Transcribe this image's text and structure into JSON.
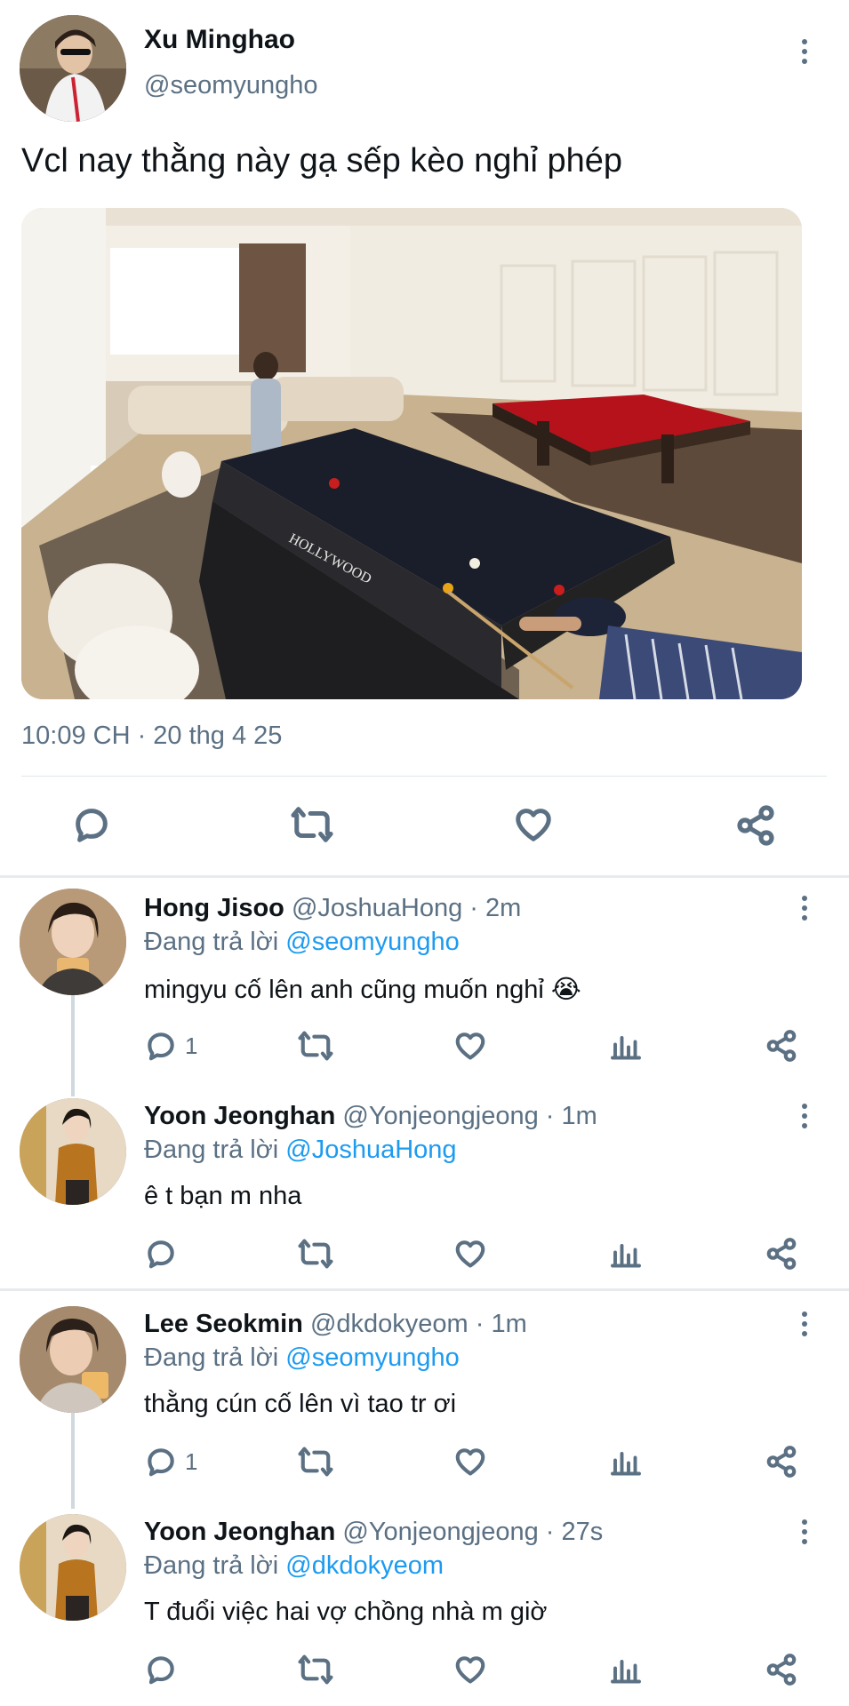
{
  "tweet": {
    "author": "Xu Minghao",
    "handle": "@seomyungho",
    "text": "Vcl nay thằng này gạ sếp kèo nghỉ phép",
    "timestamp": "10:09 CH · 20 thg 4 25",
    "photo_text": "HOLLYWOOD"
  },
  "replies": [
    {
      "name": "Hong Jisoo",
      "handle": "@JoshuaHong",
      "time": "· 2m",
      "replying_prefix": "Đang trả lời",
      "replying_to": "@seomyungho",
      "text": "mingyu cố lên anh cũng muốn nghỉ 😭",
      "reply_count": "1"
    },
    {
      "name": "Yoon Jeonghan",
      "handle": "@Yonjeongjeong",
      "time": "· 1m",
      "replying_prefix": "Đang trả lời",
      "replying_to": "@JoshuaHong",
      "text": "ê t bạn m nha",
      "reply_count": ""
    },
    {
      "name": "Lee Seokmin",
      "handle": "@dkdokyeom",
      "time": "· 1m",
      "replying_prefix": "Đang trả lời",
      "replying_to": "@seomyungho",
      "text": "thằng cún cố lên vì tao tr ơi",
      "reply_count": "1"
    },
    {
      "name": "Yoon Jeonghan",
      "handle": "@Yonjeongjeong",
      "time": "· 27s",
      "replying_prefix": "Đang trả lời",
      "replying_to": "@dkdokyeom",
      "text": "T đuổi việc hai vợ chồng nhà m giờ",
      "reply_count": ""
    }
  ],
  "icons": [
    "reply-icon",
    "retweet-icon",
    "like-icon",
    "share-icon",
    "analytics-icon",
    "more-icon"
  ],
  "colors": {
    "link": "#1d9bf0",
    "muted": "#5b7083",
    "text": "#0f1419"
  }
}
